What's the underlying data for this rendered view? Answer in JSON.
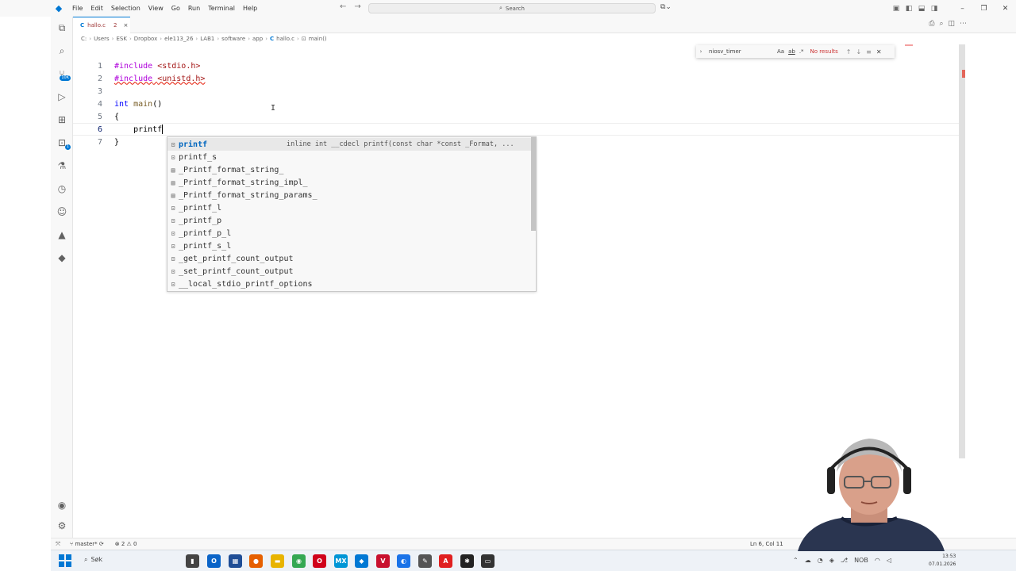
{
  "menu": [
    "File",
    "Edit",
    "Selection",
    "View",
    "Go",
    "Run",
    "Terminal",
    "Help"
  ],
  "search": {
    "label": "Search"
  },
  "tab": {
    "lang": "C",
    "name": "hallo.c",
    "problems": "2",
    "close": "×"
  },
  "breadcrumb": {
    "parts": [
      "C:",
      "Users",
      "ESK",
      "Dropbox",
      "ele113_26",
      "LAB1",
      "software",
      "app"
    ],
    "file_lang": "C",
    "file": "hallo.c",
    "symbol": "main()"
  },
  "find": {
    "query": "niosv_timer",
    "match_case": "Aa",
    "whole_word": "ab",
    "regex": ".*",
    "result": "No results"
  },
  "code_lines": [
    {
      "num": "1",
      "text": "#include <stdio.h>"
    },
    {
      "num": "2",
      "text": "#include <unistd.h>"
    },
    {
      "num": "3",
      "text": ""
    },
    {
      "num": "4",
      "text": "int main()"
    },
    {
      "num": "5",
      "text": "{"
    },
    {
      "num": "6",
      "text": "    printf"
    },
    {
      "num": "7",
      "text": "}"
    }
  ],
  "suggestions": [
    {
      "label": "printf",
      "match": "printf",
      "detail": "inline int __cdecl printf(const char *const _Format, ..."
    },
    {
      "label": "printf_s"
    },
    {
      "label": "_Printf_format_string_"
    },
    {
      "label": "_Printf_format_string_impl_"
    },
    {
      "label": "_Printf_format_string_params_"
    },
    {
      "label": "_printf_l"
    },
    {
      "label": "_printf_p"
    },
    {
      "label": "_printf_p_l"
    },
    {
      "label": "_printf_s_l"
    },
    {
      "label": "_get_printf_count_output"
    },
    {
      "label": "_set_printf_count_output"
    },
    {
      "label": "__local_stdio_printf_options"
    }
  ],
  "status": {
    "branch": "master*",
    "errors": "2",
    "warnings": "0",
    "position": "Ln 6, Col 11"
  },
  "taskbar": {
    "search": "Søk",
    "lang": "NOB",
    "time": "13:53",
    "date": "07.01.2026"
  },
  "activity_badges": {
    "source_control": "10K",
    "remote": "1"
  },
  "colors": {
    "accent": "#0078d4",
    "error": "#e51400",
    "keyword": "#af00db",
    "string": "#a31515"
  }
}
